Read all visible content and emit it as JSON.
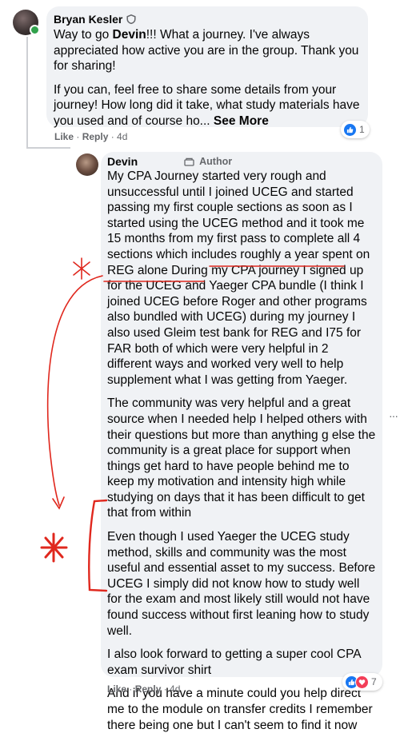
{
  "comment1": {
    "author": "Bryan Kesler",
    "paragraph1_pre": "Way to go ",
    "paragraph1_mention": "Devin",
    "paragraph1_post": "!!! What a journey. I've always appreciated how active you are in the group. Thank you for sharing!",
    "paragraph2": "If you can, feel free to share some details from your journey! How long did it take, what study materials have you used and of course ho...",
    "see_more": "See More",
    "like_label": "Like",
    "reply_label": "Reply",
    "time": "4d",
    "reaction_count": "1"
  },
  "comment2": {
    "author": "Devin",
    "author_badge": "Author",
    "paragraphs": [
      "My CPA Journey started very rough and unsuccessful until I joined UCEG and started passing my first couple sections as soon as I started using the UCEG method and it took me 15 months from my first pass to complete all 4 sections which includes roughly a year spent on REG alone During my CPA journey I signed up for the UCEG and Yaeger CPA bundle (I think I joined UCEG before Roger and other programs also bundled with UCEG) during my journey I also used Gleim test bank for REG and I75 for FAR both of which were very helpful in 2 different ways and worked very well to help supplement what I was getting from Yaeger.",
      "The community was very helpful and a great source when I needed help I helped others with their questions but more than anything g else the community is a great place for support when things get hard to have people behind me to keep my motivation and intensity high while studying on days that it has been difficult to get that from within",
      "Even though I used Yaeger the UCEG study method, skills and community was the most useful and essential asset to my success. Before UCEG I simply did not know how to study well for the exam and most likely still would not have found success without first leaning how to study well.",
      "I also look forward to getting a super cool CPA exam survivor shirt",
      "And if you have a minute could you help direct me to the module on transfer credits I remember there being one but I can't seem to find it now"
    ],
    "like_label": "Like",
    "reply_label": "Reply",
    "time": "4d",
    "reaction_count": "7"
  },
  "colors": {
    "bubble": "#f0f2f5",
    "annotation": "#e0281e",
    "like": "#1877f2",
    "love": "#f33e58"
  }
}
